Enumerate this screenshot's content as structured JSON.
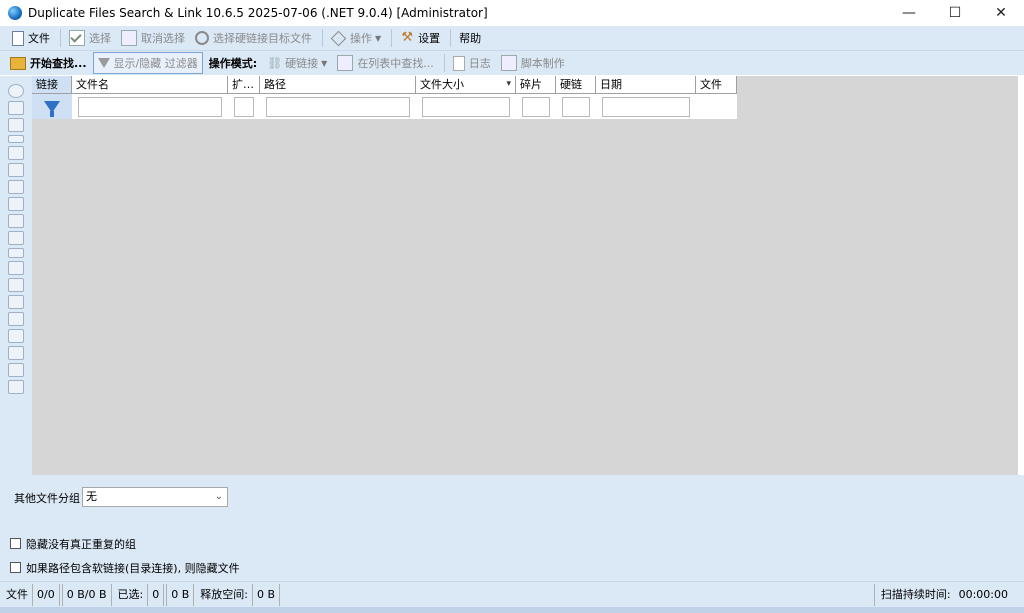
{
  "window": {
    "title": "Duplicate Files Search & Link 10.6.5 2025-07-06 (.NET 9.0.4) [Administrator]",
    "controls": {
      "minimize": "—",
      "maximize": "☐",
      "close": "✕"
    }
  },
  "menubar": {
    "file": "文件",
    "select": "选择",
    "deselect": "取消选择",
    "select_hardlink_target": "选择硬链接目标文件",
    "actions": "操作",
    "settings": "设置",
    "help": "帮助"
  },
  "toolbar": {
    "start_search": "开始查找...",
    "toggle_filter": "显示/隐藏 过滤器",
    "mode_label": "操作模式:",
    "hardlink": "硬链接",
    "find_in_list": "在列表中查找...",
    "log": "日志",
    "script": "脚本制作"
  },
  "grid": {
    "columns": [
      "链接",
      "文件名",
      "扩…",
      "路径",
      "文件大小",
      "碎片",
      "硬链",
      "日期",
      "文件"
    ],
    "size_sort_indicator": "▾"
  },
  "bottom": {
    "group_label": "其他文件分组",
    "group_value": "无",
    "hide_no_dupes": "隐藏没有真正重复的组",
    "hide_symlink": "如果路径包含软链接(目录连接), 则隐藏文件"
  },
  "status": {
    "files_label": "文件",
    "files_value": "0/0",
    "size_value": "0 B/0 B",
    "selected_label": "已选:",
    "selected_count": "0",
    "selected_size": "0 B",
    "free_label": "释放空间:",
    "free_value": "0 B",
    "scan_label": "扫描持续时间:",
    "scan_value": "00:00:00"
  },
  "icons": {
    "app": "globe-icon",
    "funnel": "filter-funnel-icon"
  }
}
